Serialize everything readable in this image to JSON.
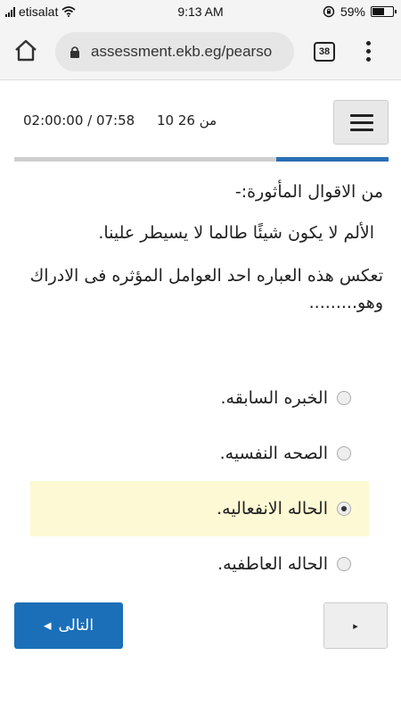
{
  "status_bar": {
    "carrier": "etisalat",
    "time": "9:13 AM",
    "battery": "59%",
    "battery_level": 0.59
  },
  "browser": {
    "url": "assessment.ekb.eg/pearso",
    "tab_count": "38"
  },
  "quiz": {
    "timer": "02:00:00 / 07:58",
    "question_count": "10 من 26",
    "progress": 0.3
  },
  "question": {
    "intro": "من الاقوال المأثورة:-",
    "quote": "الألم لا يكون شيئًا طالما لا يسيطر علينا.",
    "body": "تعكس هذه العباره احد العوامل المؤثره فى الادراك وهو.........",
    "options": [
      {
        "label": "الخبره السابقه.",
        "selected": false
      },
      {
        "label": "الصحه النفسيه.",
        "selected": false
      },
      {
        "label": "الحاله الانفعاليه.",
        "selected": true
      },
      {
        "label": "الحاله العاطفيه.",
        "selected": false
      }
    ]
  },
  "nav": {
    "next_label": "التالى",
    "next_arrow": "◂",
    "prev_arrow": "▸"
  },
  "colors": {
    "accent": "#1b6fb8",
    "selected_bg": "#fcf9d4",
    "progress": "#2a6fb5"
  }
}
